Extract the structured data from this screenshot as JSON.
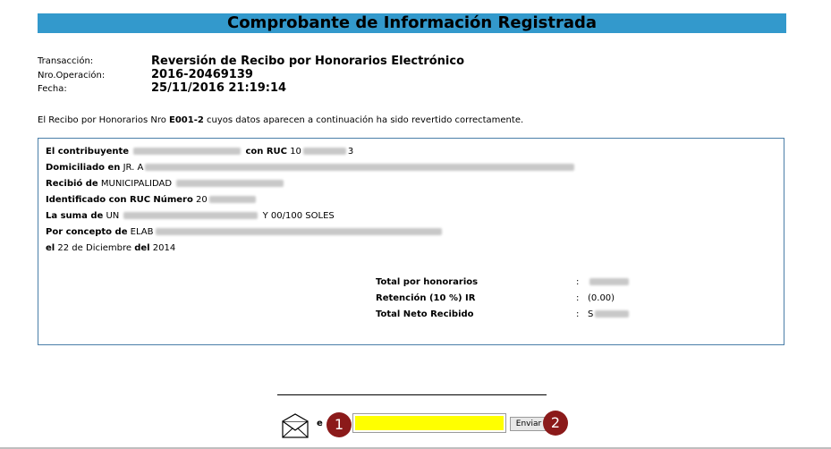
{
  "header": {
    "title": "Comprobante de Información Registrada"
  },
  "meta": {
    "transaction_label": "Transacción:",
    "transaction_value": "Reversión de Recibo por Honorarios Electrónico",
    "operation_label": "Nro.Operación:",
    "operation_value": "2016-20469139",
    "date_label": "Fecha:",
    "date_value": "25/11/2016 21:19:14"
  },
  "notice": {
    "prefix": "El Recibo por Honorarios Nro ",
    "receipt_number": "E001-2",
    "suffix": " cuyos datos aparecen a continuación ha sido revertido correctamente."
  },
  "receipt": {
    "contributor_label": "El contribuyente",
    "ruc_label": "con RUC",
    "ruc_prefix": "10",
    "ruc_suffix": "3",
    "address_label": "Domiciliado en",
    "address_prefix": "JR. A",
    "received_label": "Recibió de",
    "received_value": "MUNICIPALIDAD",
    "identified_label": "Identificado con RUC",
    "number_label": "Número",
    "identified_prefix": "20",
    "sum_label": "La suma de",
    "sum_prefix": "UN",
    "sum_suffix": "Y 00/100 SOLES",
    "concept_label": "Por concepto de",
    "concept_prefix": "ELAB",
    "date_el": "el",
    "date_day": "22 de",
    "date_month": "Diciembre",
    "date_del": "del",
    "date_year": "2014"
  },
  "totals": {
    "honorarios_label": "Total por honorarios",
    "retencion_label": "Retención (10 %) IR",
    "retencion_value": "(0.00)",
    "neto_label": "Total Neto Recibido",
    "neto_prefix": "S",
    "colon": ":"
  },
  "email": {
    "e_label": "e",
    "send_label": "Enviar",
    "badge_1": "1",
    "badge_2": "2"
  }
}
